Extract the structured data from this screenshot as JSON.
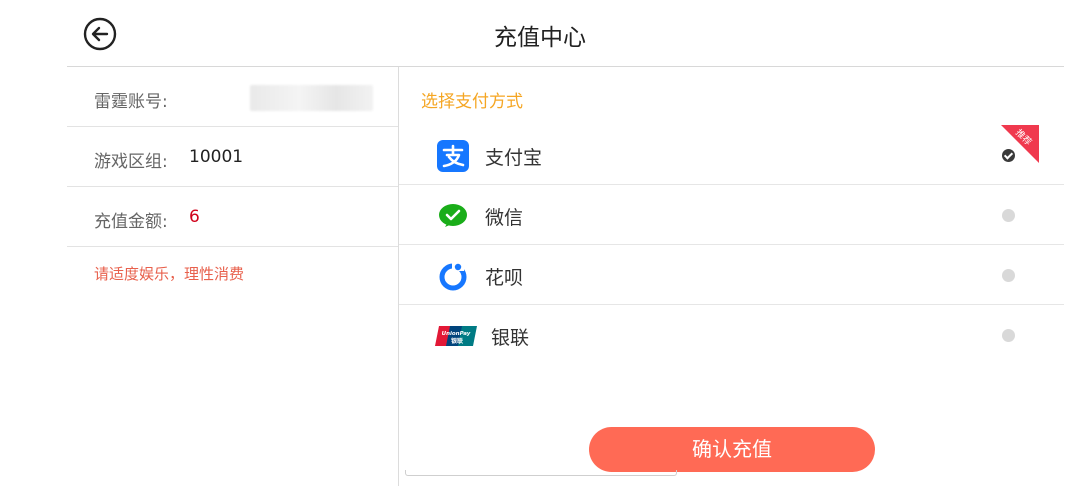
{
  "header": {
    "title": "充值中心",
    "back_icon": "back-arrow-icon"
  },
  "account": {
    "rows": [
      {
        "label": "雷霆账号:",
        "value": ""
      },
      {
        "label": "游戏区组:",
        "value": "10001"
      },
      {
        "label": "充值金额:",
        "value": "6"
      }
    ],
    "notice": "请适度娱乐，理性消费"
  },
  "payment": {
    "section_title": "选择支付方式",
    "badge_text": "推荐",
    "methods": [
      {
        "name": "支付宝",
        "icon": "alipay-icon",
        "selected": true
      },
      {
        "name": "微信",
        "icon": "wechat-icon",
        "selected": false
      },
      {
        "name": "花呗",
        "icon": "huabei-icon",
        "selected": false
      },
      {
        "name": "银联",
        "icon": "unionpay-icon",
        "selected": false
      }
    ],
    "confirm_label": "确认充值"
  },
  "colors": {
    "accent_orange": "#f5a623",
    "button": "#ff6a55",
    "amount": "#d0021b",
    "notice": "#e8604c",
    "badge": "#f0394e"
  }
}
